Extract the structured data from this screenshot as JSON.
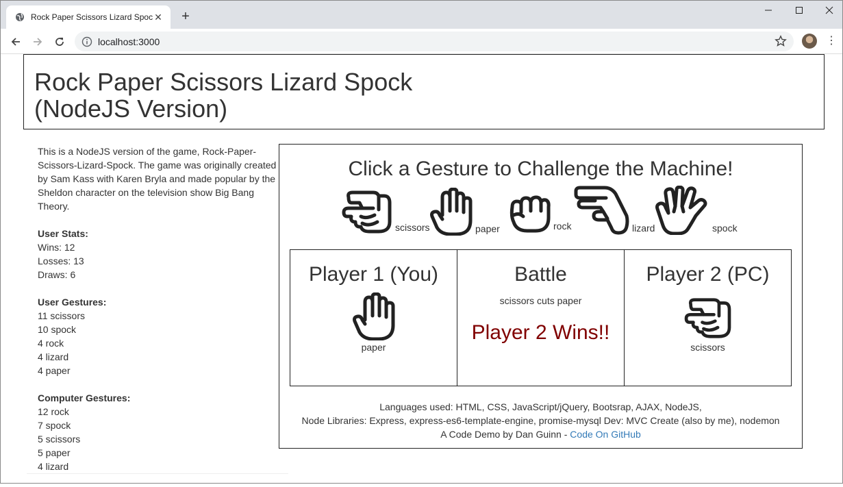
{
  "browser": {
    "tab_title": "Rock Paper Scissors Lizard Spock",
    "url": "localhost:3000"
  },
  "header": {
    "title_line1": "Rock Paper Scissors Lizard Spock",
    "title_line2": "(NodeJS Version)"
  },
  "sidebar": {
    "intro": "This is a NodeJS version of the game, Rock-Paper-Scissors-Lizard-Spock. The game was originally created by Sam Kass with Karen Bryla and made popular by the Sheldon character on the television show Big Bang Theory.",
    "user_stats": {
      "heading": "User Stats:",
      "items": [
        "Wins: 12",
        "Losses: 13",
        "Draws: 6"
      ]
    },
    "user_gestures": {
      "heading": "User Gestures:",
      "items": [
        "11 scissors",
        "10 spock",
        "4 rock",
        "4 lizard",
        "4 paper"
      ]
    },
    "computer_gestures": {
      "heading": "Computer Gestures:",
      "items": [
        "12 rock",
        "7 spock",
        "5 scissors",
        "5 paper",
        "4 lizard"
      ]
    }
  },
  "game": {
    "title": "Click a Gesture to Challenge the Machine!",
    "gestures": [
      {
        "label": "scissors",
        "icon": "scissors-hand-icon"
      },
      {
        "label": "paper",
        "icon": "paper-hand-icon"
      },
      {
        "label": "rock",
        "icon": "rock-hand-icon"
      },
      {
        "label": "lizard",
        "icon": "lizard-hand-icon"
      },
      {
        "label": "spock",
        "icon": "spock-hand-icon"
      }
    ],
    "player1": {
      "title": "Player 1 (You)",
      "gesture": "paper"
    },
    "battle": {
      "title": "Battle",
      "description": "scissors cuts paper",
      "result": "Player 2 Wins!!",
      "result_color": "#800000"
    },
    "player2": {
      "title": "Player 2 (PC)",
      "gesture": "scissors"
    }
  },
  "footer": {
    "line1": "Languages used: HTML, CSS, JavaScript/jQuery, Bootsrap, AJAX, NodeJS,",
    "line2": "Node Libraries: Express, express-es6-template-engine, promise-mysql Dev: MVC Create (also by me), nodemon",
    "line3_prefix": "A Code Demo by Dan Guinn - ",
    "link_text": "Code On GitHub",
    "link_color": "#337ab7"
  }
}
